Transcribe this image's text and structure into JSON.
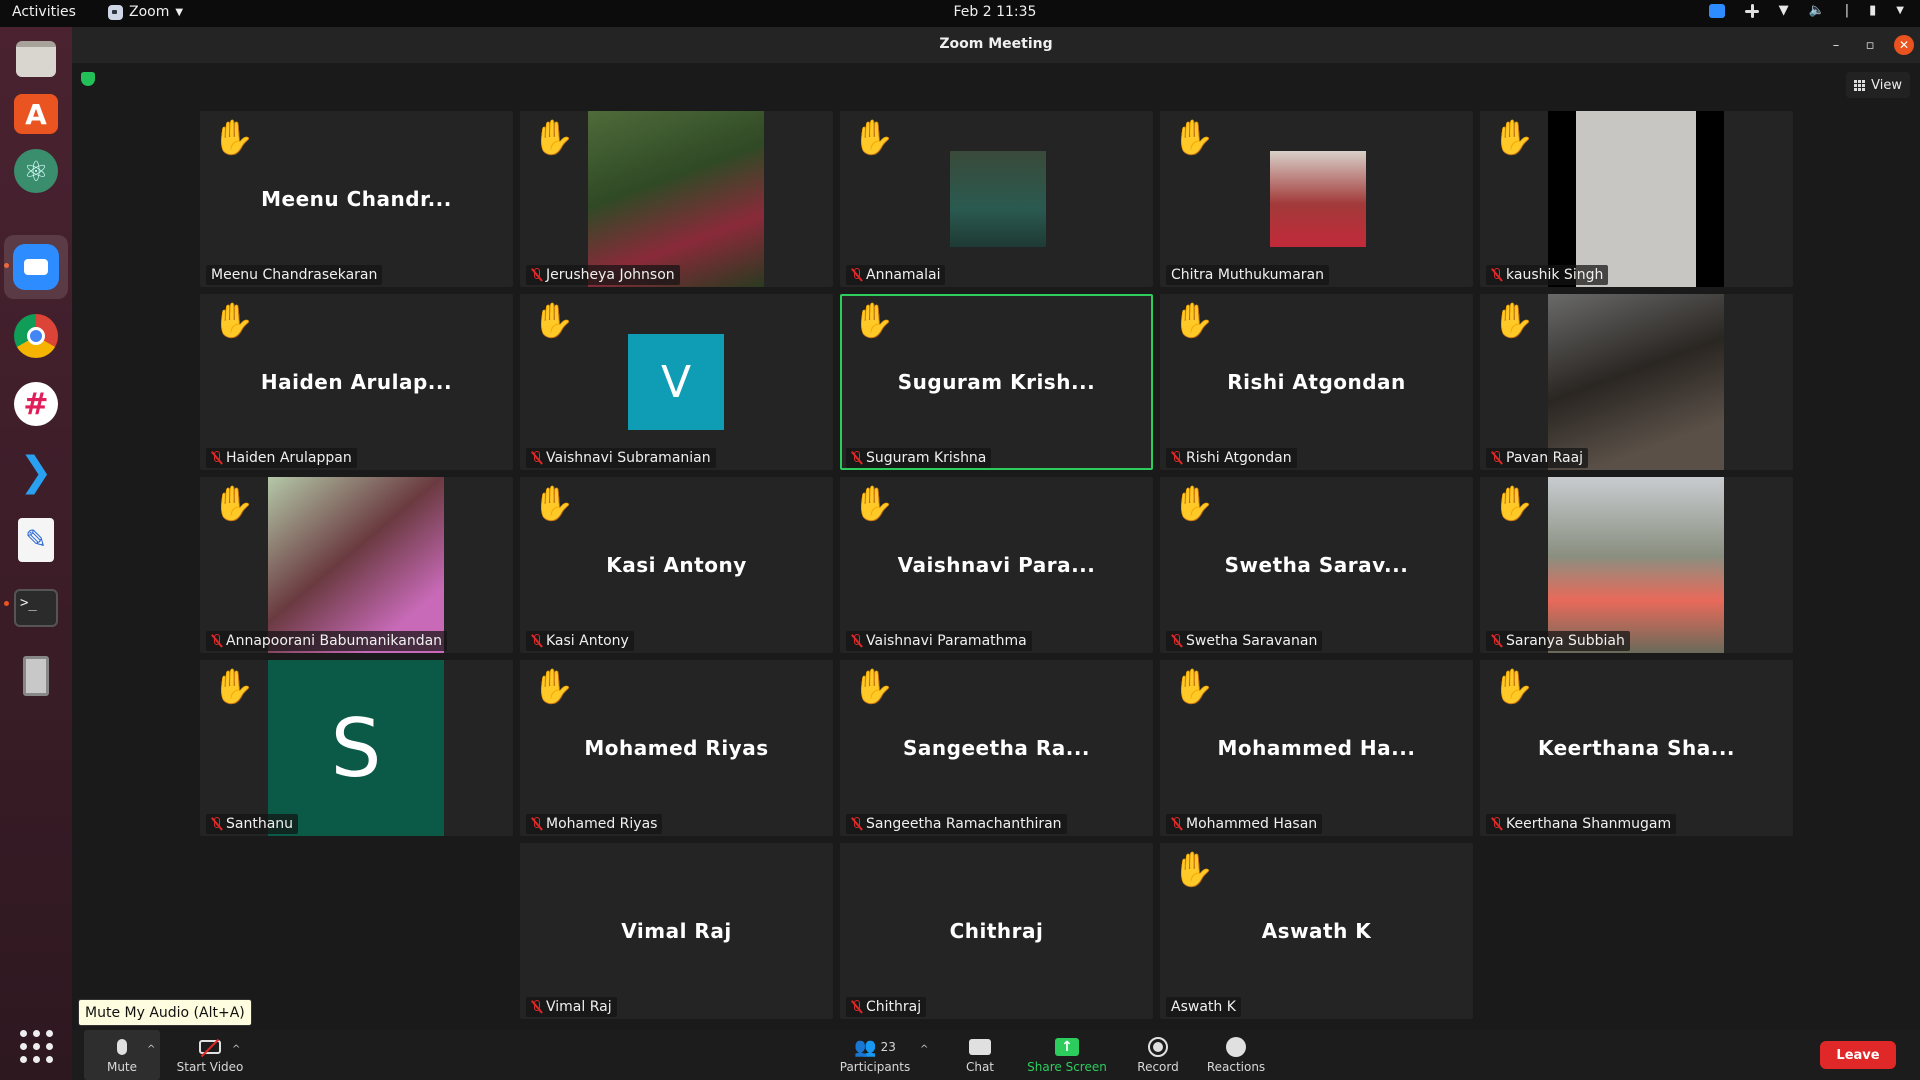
{
  "topbar": {
    "activities": "Activities",
    "app_name": "Zoom",
    "datetime": "Feb 2  11:35"
  },
  "window": {
    "title": "Zoom Meeting",
    "view_label": "View"
  },
  "participants": [
    {
      "display": "Meenu Chandr...",
      "name": "Meenu Chandrasekaran",
      "muted": false,
      "hand": true
    },
    {
      "display": "",
      "name": "Jerusheya Johnson",
      "muted": true,
      "hand": true
    },
    {
      "display": "",
      "name": "Annamalai",
      "muted": true,
      "hand": true
    },
    {
      "display": "",
      "name": "Chitra Muthukumaran",
      "muted": false,
      "hand": true
    },
    {
      "display": "",
      "name": "kaushik Singh",
      "muted": true,
      "hand": true
    },
    {
      "display": "Haiden Arulap...",
      "name": "Haiden Arulappan",
      "muted": true,
      "hand": true
    },
    {
      "display": "V",
      "name": "Vaishnavi Subramanian",
      "muted": true,
      "hand": true
    },
    {
      "display": "Suguram Krish...",
      "name": "Suguram Krishna",
      "muted": true,
      "hand": true
    },
    {
      "display": "Rishi Atgondan",
      "name": "Rishi Atgondan",
      "muted": true,
      "hand": true
    },
    {
      "display": "",
      "name": "Pavan Raaj",
      "muted": true,
      "hand": true
    },
    {
      "display": "",
      "name": "Annapoorani Babumanikandan",
      "muted": true,
      "hand": true
    },
    {
      "display": "Kasi Antony",
      "name": "Kasi Antony",
      "muted": true,
      "hand": true
    },
    {
      "display": "Vaishnavi Para...",
      "name": "Vaishnavi Paramathma",
      "muted": true,
      "hand": true
    },
    {
      "display": "Swetha Sarav...",
      "name": "Swetha Saravanan",
      "muted": true,
      "hand": true
    },
    {
      "display": "",
      "name": "Saranya Subbiah",
      "muted": true,
      "hand": true
    },
    {
      "display": "S",
      "name": "Santhanu",
      "muted": true,
      "hand": true
    },
    {
      "display": "Mohamed Riyas",
      "name": "Mohamed Riyas",
      "muted": true,
      "hand": true
    },
    {
      "display": "Sangeetha Ra...",
      "name": "Sangeetha Ramachanthiran",
      "muted": true,
      "hand": true
    },
    {
      "display": "Mohammed Ha...",
      "name": "Mohammed Hasan",
      "muted": true,
      "hand": true
    },
    {
      "display": "Keerthana Sha...",
      "name": "Keerthana Shanmugam",
      "muted": true,
      "hand": true
    },
    {
      "display": "Vimal Raj",
      "name": "Vimal Raj",
      "muted": true,
      "hand": false
    },
    {
      "display": "Chithraj",
      "name": "Chithraj",
      "muted": true,
      "hand": false
    },
    {
      "display": "Aswath K",
      "name": "Aswath K",
      "muted": false,
      "hand": true
    }
  ],
  "active_speaker": "Suguram Krishna",
  "tooltip": "Mute My Audio (Alt+A)",
  "toolbar": {
    "mute": "Mute",
    "start_video": "Start Video",
    "participants": "Participants",
    "participant_count": "23",
    "chat": "Chat",
    "share_screen": "Share Screen",
    "record": "Record",
    "reactions": "Reactions",
    "leave": "Leave"
  },
  "colors": {
    "share_green": "#2ccd5d",
    "leave_red": "#e02828",
    "active_border": "#2ccd5d",
    "avatar_v": "#0e9db5",
    "avatar_s": "#0a5a47"
  }
}
